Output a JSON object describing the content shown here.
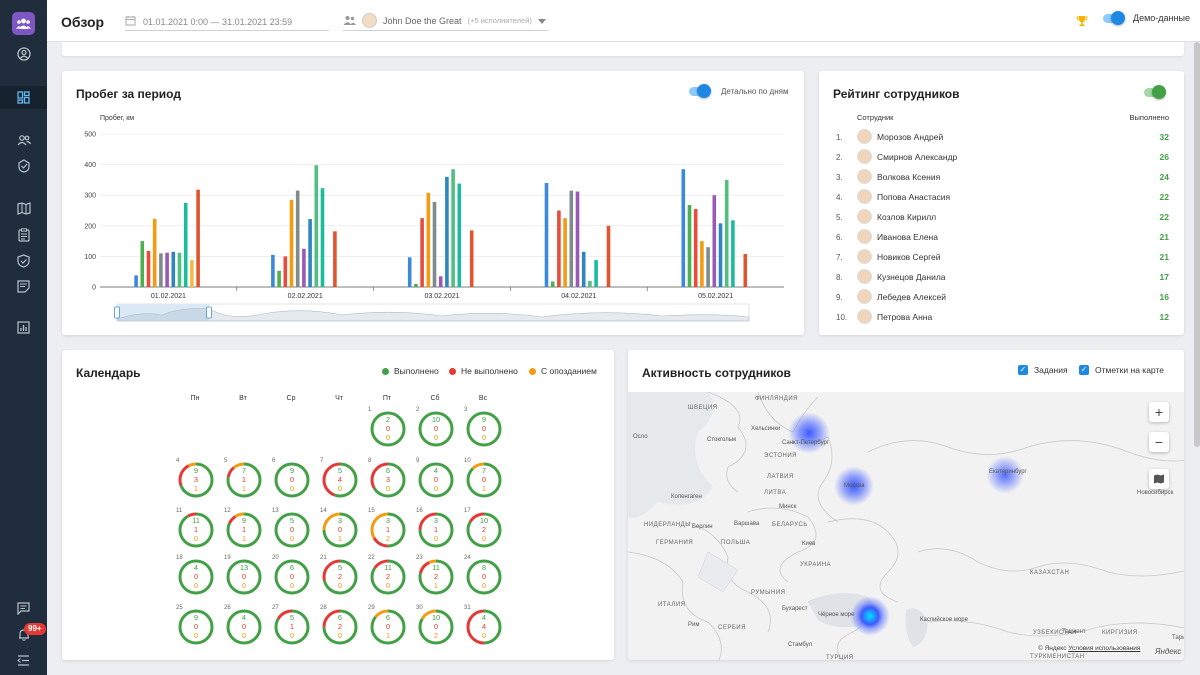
{
  "header": {
    "title": "Обзор",
    "date_range": "01.01.2021 0:00 — 31.01.2021 23:59",
    "user": "John Doe the Great",
    "user_extra": "(+5 исполнителей)",
    "demo_label": "Демо-данные"
  },
  "sidebar": {
    "badge": "99+",
    "items": [
      {
        "icon": "account-circle-icon"
      },
      {
        "icon": "dashboard-icon"
      },
      {
        "icon": "people-icon"
      },
      {
        "icon": "route-check-icon"
      },
      {
        "icon": "map-icon"
      },
      {
        "icon": "clipboard-icon"
      },
      {
        "icon": "shield-check-icon"
      },
      {
        "icon": "note-icon"
      },
      {
        "icon": "bar-chart-icon"
      },
      {
        "icon": "chat-icon"
      },
      {
        "icon": "bell-icon"
      },
      {
        "icon": "collapse-menu-icon"
      }
    ]
  },
  "mileage": {
    "title": "Пробег за период",
    "toggle_label": "Детально по дням"
  },
  "chart_data": {
    "type": "bar",
    "title": "Пробег за период",
    "ylabel": "Пробег, км",
    "xlabel": "",
    "ylim": [
      0,
      500
    ],
    "yticks": [
      0,
      100,
      200,
      300,
      400,
      500
    ],
    "categories": [
      "01.02.2021",
      "02.02.2021",
      "03.02.2021",
      "04.02.2021",
      "05.02.2021"
    ],
    "colors": [
      "#3b8ad9",
      "#4caf50",
      "#e74c3c",
      "#f39c12",
      "#7f8c8d",
      "#9b59b6",
      "#2e86c1",
      "#52be80",
      "#1abc9c",
      "#f4b942",
      "#e0552e"
    ],
    "bars": [
      [
        38,
        150,
        118,
        223,
        110,
        112,
        115,
        112,
        275,
        88,
        318
      ],
      [
        105,
        53,
        100,
        285,
        315,
        125,
        222,
        398,
        323,
        0,
        182
      ],
      [
        97,
        10,
        225,
        308,
        278,
        35,
        360,
        385,
        338,
        0,
        185
      ],
      [
        340,
        18,
        250,
        225,
        315,
        312,
        115,
        20,
        88,
        0,
        200
      ],
      [
        385,
        268,
        255,
        150,
        130,
        300,
        208,
        350,
        218,
        0,
        108
      ]
    ]
  },
  "rating": {
    "title": "Рейтинг сотрудников",
    "col_employee": "Сотрудник",
    "col_done": "Выполнено",
    "rows": [
      {
        "num": "1.",
        "name": "Морозов Андрей",
        "score": "32"
      },
      {
        "num": "2.",
        "name": "Смирнов Александр",
        "score": "26"
      },
      {
        "num": "3.",
        "name": "Волкова Ксения",
        "score": "24"
      },
      {
        "num": "4.",
        "name": "Попова Анастасия",
        "score": "22"
      },
      {
        "num": "5.",
        "name": "Козлов Кирилл",
        "score": "22"
      },
      {
        "num": "6.",
        "name": "Иванова Елена",
        "score": "21"
      },
      {
        "num": "7.",
        "name": "Новиков Сергей",
        "score": "21"
      },
      {
        "num": "8.",
        "name": "Кузнецов Данила",
        "score": "17"
      },
      {
        "num": "9.",
        "name": "Лебедев Алексей",
        "score": "16"
      },
      {
        "num": "10.",
        "name": "Петрова Анна",
        "score": "12"
      }
    ]
  },
  "calendar": {
    "title": "Календарь",
    "legend": [
      {
        "label": "Выполнено",
        "color": "#43a047"
      },
      {
        "label": "Не выполнено",
        "color": "#e53935"
      },
      {
        "label": "С опозданием",
        "color": "#f39c12"
      }
    ],
    "weekdays": [
      "Пн",
      "Вт",
      "Ср",
      "Чт",
      "Пт",
      "Сб",
      "Вс"
    ],
    "days": [
      {
        "d": "1",
        "c": 4,
        "r": 0,
        "g": "2",
        "rr": "0",
        "o": "0"
      },
      {
        "d": "2",
        "c": 5,
        "r": 0,
        "g": "10",
        "rr": "0",
        "o": "0"
      },
      {
        "d": "3",
        "c": 6,
        "r": 0,
        "g": "9",
        "rr": "0",
        "o": "0"
      },
      {
        "d": "4",
        "c": 0,
        "r": 1,
        "g": "9",
        "rr": "3",
        "o": "1"
      },
      {
        "d": "5",
        "c": 1,
        "r": 1,
        "g": "7",
        "rr": "1",
        "o": "1"
      },
      {
        "d": "6",
        "c": 2,
        "r": 1,
        "g": "9",
        "rr": "0",
        "o": "0"
      },
      {
        "d": "7",
        "c": 3,
        "r": 1,
        "g": "5",
        "rr": "4",
        "o": "0"
      },
      {
        "d": "8",
        "c": 4,
        "r": 1,
        "g": "6",
        "rr": "3",
        "o": "0"
      },
      {
        "d": "9",
        "c": 5,
        "r": 1,
        "g": "4",
        "rr": "0",
        "o": "0"
      },
      {
        "d": "10",
        "c": 6,
        "r": 1,
        "g": "7",
        "rr": "0",
        "o": "1"
      },
      {
        "d": "11",
        "c": 0,
        "r": 2,
        "g": "11",
        "rr": "1",
        "o": "0"
      },
      {
        "d": "12",
        "c": 1,
        "r": 2,
        "g": "9",
        "rr": "1",
        "o": "1"
      },
      {
        "d": "13",
        "c": 2,
        "r": 2,
        "g": "5",
        "rr": "0",
        "o": "0"
      },
      {
        "d": "14",
        "c": 3,
        "r": 2,
        "g": "3",
        "rr": "0",
        "o": "1"
      },
      {
        "d": "15",
        "c": 4,
        "r": 2,
        "g": "3",
        "rr": "1",
        "o": "2"
      },
      {
        "d": "16",
        "c": 5,
        "r": 2,
        "g": "3",
        "rr": "1",
        "o": "0"
      },
      {
        "d": "17",
        "c": 6,
        "r": 2,
        "g": "10",
        "rr": "2",
        "o": "0"
      },
      {
        "d": "18",
        "c": 0,
        "r": 3,
        "g": "4",
        "rr": "0",
        "o": "0"
      },
      {
        "d": "19",
        "c": 1,
        "r": 3,
        "g": "13",
        "rr": "0",
        "o": "0"
      },
      {
        "d": "20",
        "c": 2,
        "r": 3,
        "g": "6",
        "rr": "0",
        "o": "0"
      },
      {
        "d": "21",
        "c": 3,
        "r": 3,
        "g": "5",
        "rr": "2",
        "o": "0"
      },
      {
        "d": "22",
        "c": 4,
        "r": 3,
        "g": "11",
        "rr": "2",
        "o": "0"
      },
      {
        "d": "23",
        "c": 5,
        "r": 3,
        "g": "11",
        "rr": "2",
        "o": "1"
      },
      {
        "d": "24",
        "c": 6,
        "r": 3,
        "g": "8",
        "rr": "0",
        "o": "0"
      },
      {
        "d": "25",
        "c": 0,
        "r": 4,
        "g": "9",
        "rr": "0",
        "o": "0"
      },
      {
        "d": "26",
        "c": 1,
        "r": 4,
        "g": "4",
        "rr": "0",
        "o": "0"
      },
      {
        "d": "27",
        "c": 2,
        "r": 4,
        "g": "5",
        "rr": "1",
        "o": "0"
      },
      {
        "d": "28",
        "c": 3,
        "r": 4,
        "g": "6",
        "rr": "2",
        "o": "0"
      },
      {
        "d": "29",
        "c": 4,
        "r": 4,
        "g": "6",
        "rr": "0",
        "o": "1"
      },
      {
        "d": "30",
        "c": 5,
        "r": 4,
        "g": "10",
        "rr": "0",
        "o": "2"
      },
      {
        "d": "31",
        "c": 6,
        "r": 4,
        "g": "4",
        "rr": "4",
        "o": "0"
      }
    ]
  },
  "activity": {
    "title": "Активность сотрудников",
    "check_tasks": "Задания",
    "check_marks": "Отметки на карте",
    "zoom_in": "+",
    "zoom_out": "−",
    "attribution_prefix": "© Яндекс",
    "attribution_link": "Условия использования",
    "brand": "Яндекс",
    "labels": [
      {
        "t": "ФИНЛЯНДИЯ",
        "caps": true
      },
      {
        "t": "ШВЕЦИЯ",
        "caps": true
      },
      {
        "t": "Хельсинки",
        "caps": false
      },
      {
        "t": "Санкт-Петербург",
        "caps": false
      },
      {
        "t": "Осло",
        "caps": false
      },
      {
        "t": "Стокгольм",
        "caps": false
      },
      {
        "t": "ЭСТОНИЯ",
        "caps": true
      },
      {
        "t": "ЛАТВИЯ",
        "caps": true
      },
      {
        "t": "Москва",
        "caps": false
      },
      {
        "t": "Екатеринбург",
        "caps": false
      },
      {
        "t": "Копенгаген",
        "caps": false
      },
      {
        "t": "ЛИТВА",
        "caps": true
      },
      {
        "t": "Минск",
        "caps": false
      },
      {
        "t": "НИДЕРЛАНДЫ",
        "caps": true
      },
      {
        "t": "Берлин",
        "caps": false
      },
      {
        "t": "Варшава",
        "caps": false
      },
      {
        "t": "БЕЛАРУСЬ",
        "caps": true
      },
      {
        "t": "ГЕРМАНИЯ",
        "caps": true
      },
      {
        "t": "ПОЛЬША",
        "caps": true
      },
      {
        "t": "Киев",
        "caps": false
      },
      {
        "t": "УКРАИНА",
        "caps": true
      },
      {
        "t": "Новосибирск",
        "caps": false
      },
      {
        "t": "КАЗАХСТАН",
        "caps": true
      },
      {
        "t": "ИТАЛИЯ",
        "caps": true
      },
      {
        "t": "РУМЫНИЯ",
        "caps": true
      },
      {
        "t": "Бухарест",
        "caps": false
      },
      {
        "t": "Рим",
        "caps": false
      },
      {
        "t": "СЕРБИЯ",
        "caps": true
      },
      {
        "t": "Чёрное море",
        "caps": false
      },
      {
        "t": "Каспийское море",
        "caps": false
      },
      {
        "t": "УЗБЕКИСТАН",
        "caps": true
      },
      {
        "t": "Ташкент",
        "caps": false
      },
      {
        "t": "КИРГИЗИЯ",
        "caps": true
      },
      {
        "t": "Стамбул",
        "caps": false
      },
      {
        "t": "ТУРЦИЯ",
        "caps": true
      },
      {
        "t": "ТУРКМЕНИСТАН",
        "caps": true
      },
      {
        "t": "Тарим",
        "caps": false
      }
    ]
  }
}
